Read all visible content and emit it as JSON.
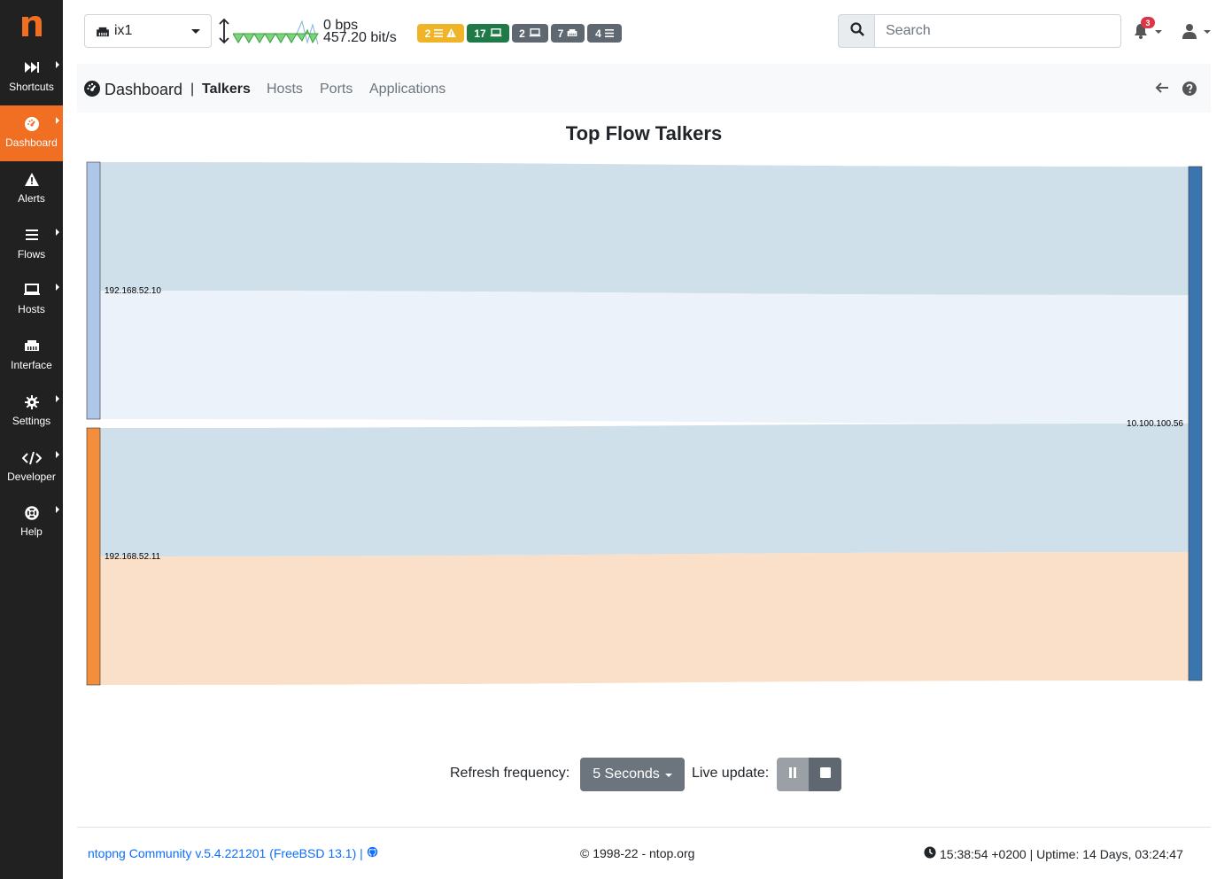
{
  "sidebar": {
    "logo": "n",
    "items": [
      {
        "label": "Shortcuts",
        "icon": "fast-forward-icon"
      },
      {
        "label": "Dashboard",
        "icon": "dashboard-gauge-icon"
      },
      {
        "label": "Alerts",
        "icon": "warning-icon"
      },
      {
        "label": "Flows",
        "icon": "list-icon"
      },
      {
        "label": "Hosts",
        "icon": "laptop-icon"
      },
      {
        "label": "Interface",
        "icon": "ethernet-icon"
      },
      {
        "label": "Settings",
        "icon": "gear-icon"
      },
      {
        "label": "Developer",
        "icon": "code-icon"
      },
      {
        "label": "Help",
        "icon": "lifebuoy-icon"
      }
    ],
    "active_color": "#f06f22"
  },
  "topbar": {
    "interface": "ix1",
    "throughput_top": "0 bps",
    "throughput_bottom": "457.20 bit/s",
    "badges": [
      {
        "value": "2",
        "color": "#f0b429"
      },
      {
        "value": "17",
        "color": "#1f7a48"
      },
      {
        "value": "2",
        "color": "#5f6870"
      },
      {
        "value": "7",
        "color": "#5f6870"
      },
      {
        "value": "4",
        "color": "#5f6870"
      }
    ],
    "search_placeholder": "Search",
    "notifications_count": "3"
  },
  "subnav": {
    "title": "Dashboard",
    "separator": "|",
    "tabs": [
      "Talkers",
      "Hosts",
      "Ports",
      "Applications"
    ],
    "active_tab": "Talkers"
  },
  "chart_data": {
    "type": "sankey",
    "title": "Top Flow Talkers",
    "nodes": [
      {
        "name": "192.168.52.10",
        "color": "#aec7e8"
      },
      {
        "name": "192.168.52.11",
        "color": "#f28e3c"
      },
      {
        "name": "10.100.100.56",
        "color": "#3b75af"
      }
    ],
    "links": [
      {
        "source": "192.168.52.10",
        "target": "10.100.100.56",
        "value": 1,
        "color": "#cfe0ea"
      },
      {
        "source": "192.168.52.10",
        "target": "10.100.100.56",
        "value": 1,
        "color": "#ecf2f9"
      },
      {
        "source": "192.168.52.11",
        "target": "10.100.100.56",
        "value": 1,
        "color": "#cfe0ea"
      },
      {
        "source": "192.168.52.11",
        "target": "10.100.100.56",
        "value": 1,
        "color": "#fae0c9"
      }
    ]
  },
  "controls": {
    "refresh_label": "Refresh frequency:",
    "refresh_value": "5 Seconds",
    "live_label": "Live update:"
  },
  "footer": {
    "left": "ntopng Community v.5.4.221201 (FreeBSD 13.1) |",
    "middle": "© 1998-22 - ntop.org",
    "right": "15:38:54 +0200 | Uptime: 14 Days, 03:24:47"
  }
}
